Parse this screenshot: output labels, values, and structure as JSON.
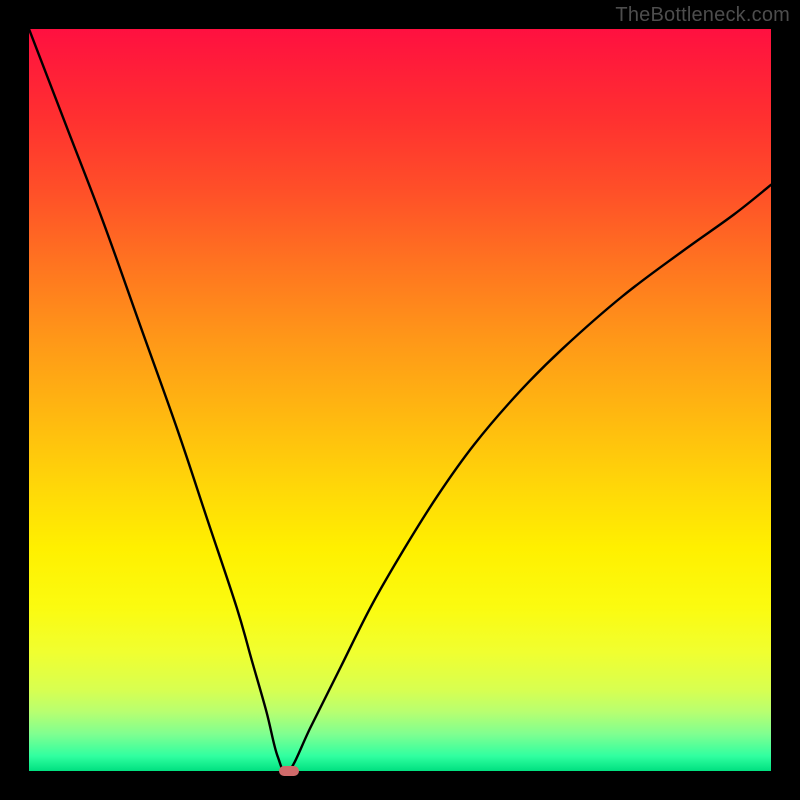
{
  "watermark": "TheBottleneck.com",
  "colors": {
    "frame": "#000000",
    "curve": "#000000",
    "marker": "#cf6a6a",
    "watermark": "#4d4d4d"
  },
  "chart_data": {
    "type": "line",
    "title": "",
    "xlabel": "",
    "ylabel": "",
    "xlim": [
      0,
      100
    ],
    "ylim": [
      0,
      100
    ],
    "grid": false,
    "legend": false,
    "series": [
      {
        "name": "bottleneck-curve",
        "x": [
          0,
          5,
          10,
          15,
          20,
          24,
          28,
          30,
          32,
          33.5,
          35,
          38,
          42,
          46,
          50,
          55,
          60,
          66,
          72,
          80,
          88,
          95,
          100
        ],
        "values": [
          100,
          87,
          74,
          60,
          46,
          34,
          22,
          15,
          8,
          2,
          0,
          6,
          14,
          22,
          29,
          37,
          44,
          51,
          57,
          64,
          70,
          75,
          79
        ]
      }
    ],
    "minimum_point": {
      "x": 35,
      "y": 0
    }
  }
}
